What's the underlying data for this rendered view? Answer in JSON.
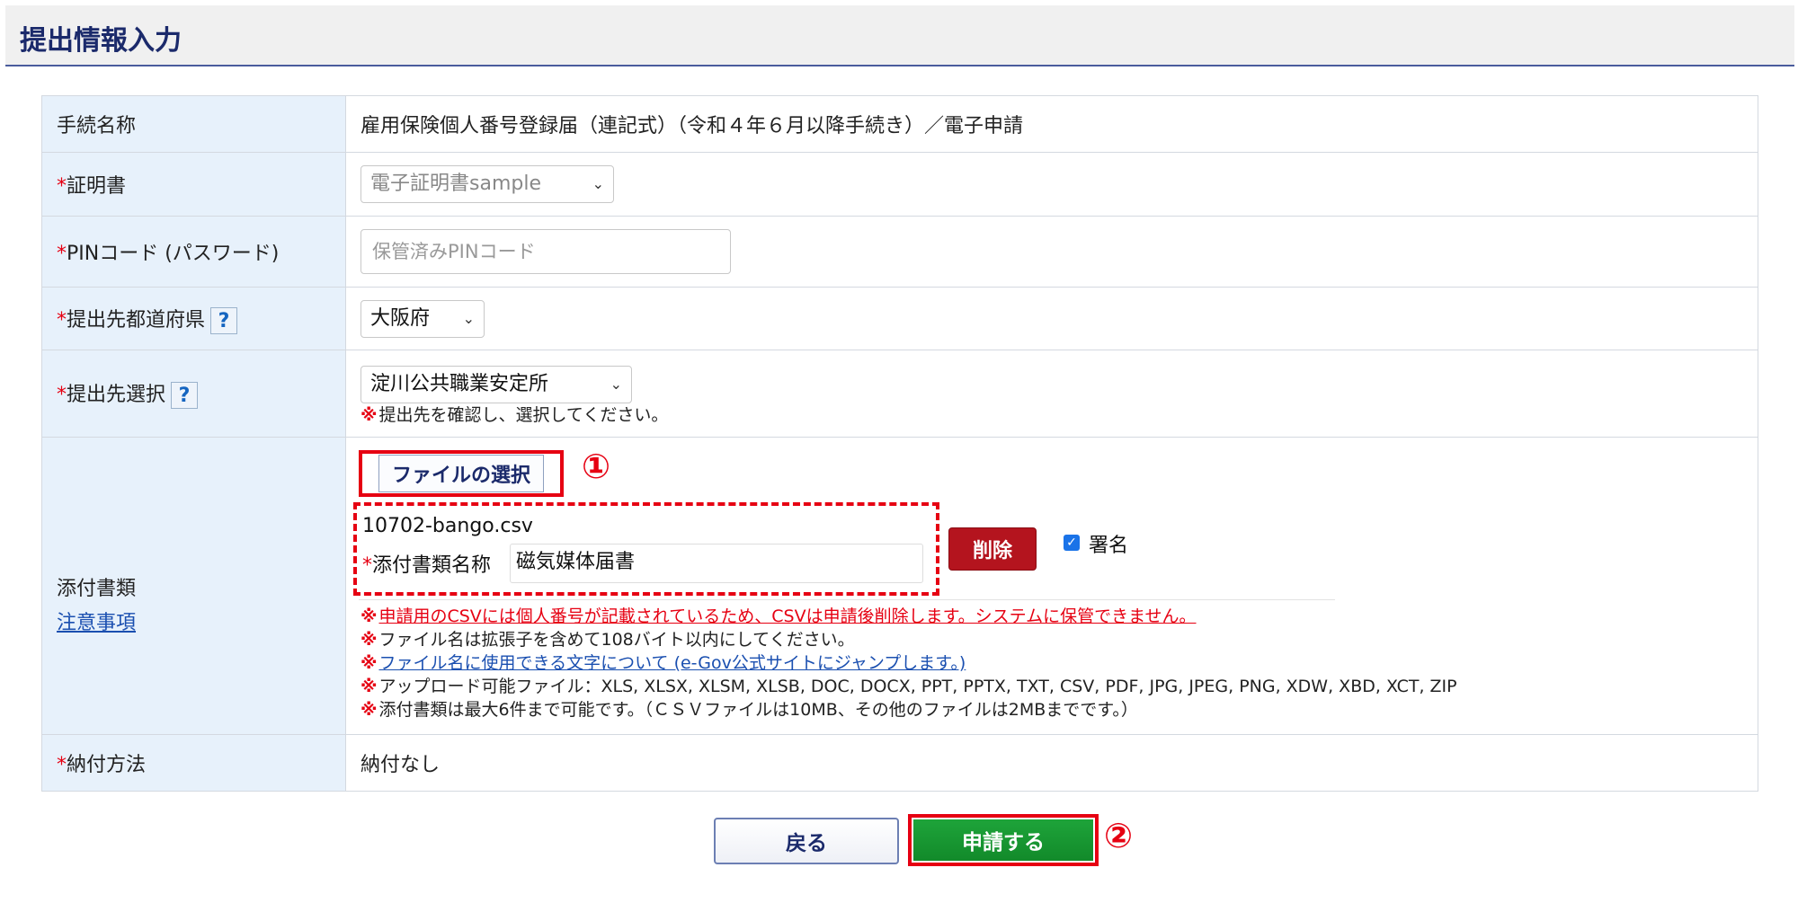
{
  "header": {
    "title": "提出情報入力"
  },
  "rows": {
    "procedure": {
      "label": "手続名称",
      "value": "雇用保険個人番号登録届（連記式）（令和４年６月以降手続き）／電子申請"
    },
    "certificate": {
      "required": "*",
      "label": "証明書",
      "selected": "電子証明書sample"
    },
    "pin": {
      "required": "*",
      "label": "PINコード (パスワード)",
      "placeholder": "保管済みPINコード"
    },
    "prefecture": {
      "required": "*",
      "label": "提出先都道府県",
      "selected": "大阪府"
    },
    "office": {
      "required": "*",
      "label": "提出先選択",
      "selected": "淀川公共職業安定所",
      "note": "提出先を確認し、選択してください。"
    },
    "attachment": {
      "label": "添付書類",
      "caution_link": "注意事項",
      "select_button": "ファイルの選択",
      "file_name": "10702-bango.csv",
      "doc_name_required": "*",
      "doc_name_label": "添付書類名称",
      "doc_name_value": "磁気媒体届書",
      "delete_button": "削除",
      "sign_label": "署名",
      "notes": [
        "申請用のCSVには個人番号が記載されているため、CSVは申請後削除します。システムに保管できません。",
        "ファイル名は拡張子を含めて108バイト以内にしてください。",
        "ファイル名に使用できる文字について (e-Gov公式サイトにジャンプします。)",
        "アップロード可能ファイル：XLS, XLSX, XLSM, XLSB, DOC, DOCX, PPT, PPTX, TXT, CSV, PDF, JPG, JPEG, PNG, XDW, XBD, XCT, ZIP",
        "添付書類は最大6件まで可能です。（ＣＳＶファイルは10MB、その他のファイルは2MBまでです。）"
      ]
    },
    "payment": {
      "required": "*",
      "label": "納付方法",
      "value": "納付なし"
    }
  },
  "note_mark": "※",
  "help_icon": "?",
  "annotations": {
    "step1": "①",
    "step2": "②"
  },
  "buttons": {
    "back": "戻る",
    "apply": "申請する"
  },
  "icons": {
    "help": "question-icon",
    "dropdown": "chevron-down-icon",
    "check": "checkbox-checked-icon"
  },
  "colors": {
    "required": "#e60012",
    "header_text": "#1b2a6b",
    "apply": "#1ea43a",
    "delete": "#b4141e",
    "label_bg": "#e7f1fb"
  }
}
